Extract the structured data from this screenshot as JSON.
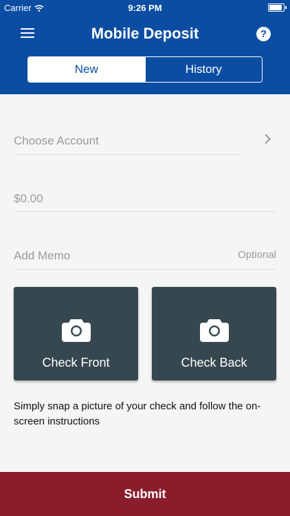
{
  "status": {
    "carrier": "Carrier",
    "time": "9:26 PM",
    "battery_level": 1.0,
    "wifi_icon": "wifi-icon"
  },
  "header": {
    "title": "Mobile Deposit",
    "menu_icon": "hamburger-menu-icon",
    "help_icon": "help-icon",
    "help_symbol": "?"
  },
  "tabs": [
    {
      "label": "New",
      "active": true
    },
    {
      "label": "History",
      "active": false
    }
  ],
  "form": {
    "account_placeholder": "Choose Account",
    "amount_placeholder": "$0.00",
    "memo_placeholder": "Add Memo",
    "memo_optional": "Optional"
  },
  "tiles": [
    {
      "label": "Check Front",
      "icon": "camera-icon"
    },
    {
      "label": "Check Back",
      "icon": "camera-icon"
    }
  ],
  "instructions": "Simply snap a picture of your check and follow the on-screen instructions",
  "submit_label": "Submit",
  "colors": {
    "brand_blue": "#0b4da2",
    "tile_dark": "#37474f",
    "submit_red": "#8a1d2c"
  }
}
